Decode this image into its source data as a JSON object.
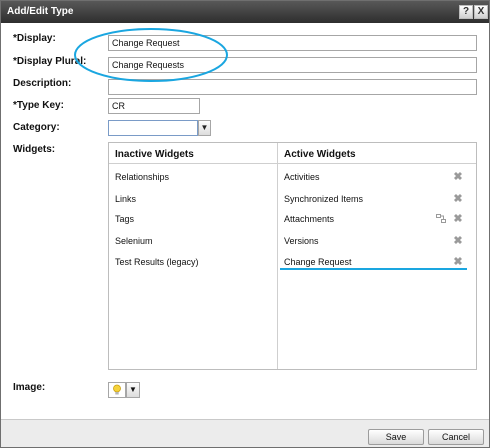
{
  "window": {
    "title": "Add/Edit Type",
    "help_label": "?",
    "close_label": "X"
  },
  "form": {
    "display_label": "*Display:",
    "display_value": "Change Request",
    "display_plural_label": "*Display Plural:",
    "display_plural_value": "Change Requests",
    "description_label": "Description:",
    "description_value": "",
    "type_key_label": "*Type Key:",
    "type_key_value": "CR",
    "category_label": "Category:",
    "category_value": "",
    "widgets_label": "Widgets:",
    "image_label": "Image:"
  },
  "widgets": {
    "inactive_header": "Inactive Widgets",
    "active_header": "Active Widgets",
    "inactive": [
      "Relationships",
      "Links",
      "Tags",
      "Selenium",
      "Test Results (legacy)"
    ],
    "active": [
      "Activities",
      "Synchronized Items",
      "Attachments",
      "Versions",
      "Change Request"
    ]
  },
  "buttons": {
    "save": "Save",
    "cancel": "Cancel"
  },
  "colors": {
    "annotation": "#1aa6e0"
  }
}
